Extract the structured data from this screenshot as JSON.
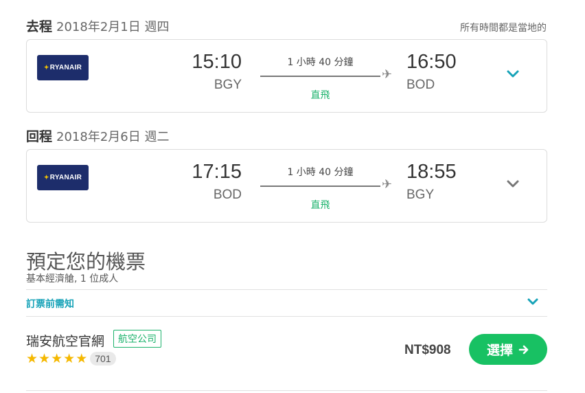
{
  "outbound": {
    "label": "去程",
    "date": "2018年2月1日 週四",
    "local_time_note": "所有時間都是當地的",
    "airline_logo_text": "RYANAIR",
    "depart_time": "15:10",
    "depart_code": "BGY",
    "duration": "1 小時 40 分鐘",
    "stops": "直飛",
    "arrive_time": "16:50",
    "arrive_code": "BOD",
    "chevron_color": "#17a3b8"
  },
  "return": {
    "label": "回程",
    "date": "2018年2月6日 週二",
    "airline_logo_text": "RYANAIR",
    "depart_time": "17:15",
    "depart_code": "BOD",
    "duration": "1 小時 40 分鐘",
    "stops": "直飛",
    "arrive_time": "18:55",
    "arrive_code": "BGY",
    "chevron_color": "#777777"
  },
  "booking": {
    "title": "預定您的機票",
    "subtitle": "基本經濟艙, 1 位成人",
    "notice_link": "訂票前需知"
  },
  "offer": {
    "vendor_name": "瑞安航空官網",
    "vendor_badge": "航空公司",
    "rating_stars": 5,
    "review_count": "701",
    "price": "NT$908",
    "select_label": "選擇"
  },
  "colors": {
    "brand_green": "#18c163",
    "link_teal": "#17a3b8",
    "ryanair_navy": "#1d2d6b",
    "star_yellow": "#f5b800"
  }
}
